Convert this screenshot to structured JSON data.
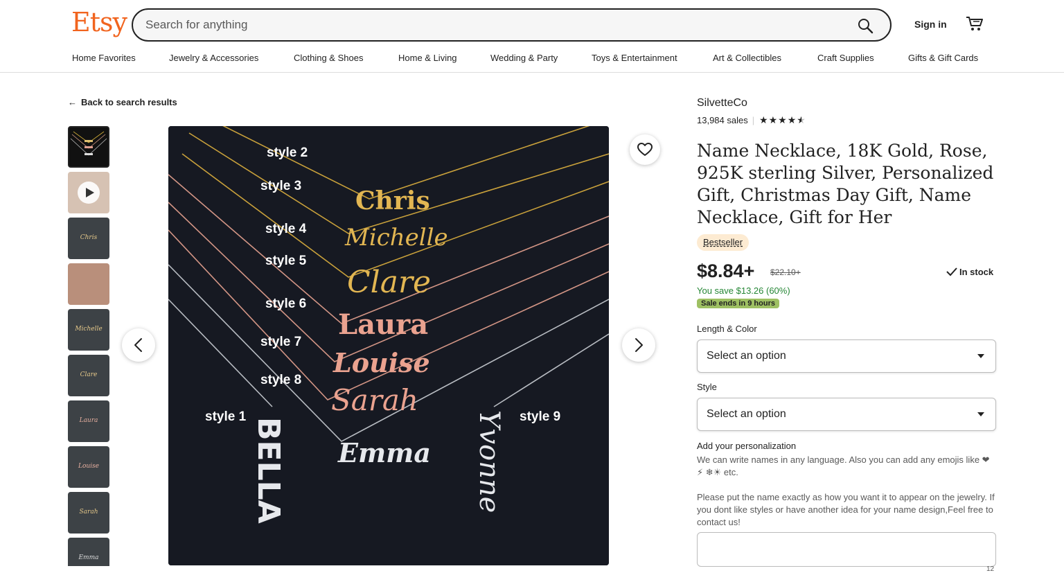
{
  "header": {
    "logo": "Etsy",
    "search_placeholder": "Search for anything",
    "sign_in": "Sign in"
  },
  "nav": [
    "Home Favorites",
    "Jewelry & Accessories",
    "Clothing & Shoes",
    "Home & Living",
    "Wedding & Party",
    "Toys & Entertainment",
    "Art & Collectibles",
    "Craft Supplies",
    "Gifts & Gift Cards"
  ],
  "back_link": "Back to search results",
  "thumbnails": [
    "",
    "",
    "Chris",
    "",
    "Michelle",
    "Clare",
    "Laura",
    "Louise",
    "Sarah",
    "Emma"
  ],
  "main_image": {
    "styles": [
      {
        "label": "style 2",
        "name": "Chris"
      },
      {
        "label": "style 3",
        "name": "Michelle"
      },
      {
        "label": "style 4",
        "name": "Clare"
      },
      {
        "label": "style 5",
        "name": "Laura"
      },
      {
        "label": "style 6",
        "name": "Louise"
      },
      {
        "label": "style 7",
        "name": "Sarah"
      },
      {
        "label": "style 8",
        "name": "Emma"
      },
      {
        "label": "style 1",
        "name": "BELLA"
      },
      {
        "label": "style 9",
        "name": "Yvonne"
      }
    ]
  },
  "product": {
    "shop_name": "SilvetteCo",
    "sales": "13,984 sales",
    "rating": 4.5,
    "title": "Name Necklace, 18K Gold, Rose, 925K sterling Silver, Personalized Gift, Christmas Day Gift, Name Necklace, Gift for Her",
    "badge": "Bestseller",
    "price": "$8.84+",
    "original_price": "$22.10+",
    "in_stock": "In stock",
    "savings": "You save $13.26 (60%)",
    "sale_ends": "Sale ends in 9 hours"
  },
  "options": [
    {
      "label": "Length & Color",
      "value": "Select an option"
    },
    {
      "label": "Style",
      "value": "Select an option"
    }
  ],
  "personalization": {
    "title": "Add your personalization",
    "line1": "We can write names in any language. Also you can add any emojis like ❤ ⚡   ❄☀  etc.",
    "line2": "Please put the name exactly as how you want it to appear on the jewelry. If you dont like styles or have another idea for your name design,Feel free to contact us!",
    "counter": "12"
  },
  "colors": {
    "brand": "#f1641e",
    "save_green": "#258635",
    "sale_badge": "#9ec063",
    "bestseller_bg": "#fdebd2"
  }
}
